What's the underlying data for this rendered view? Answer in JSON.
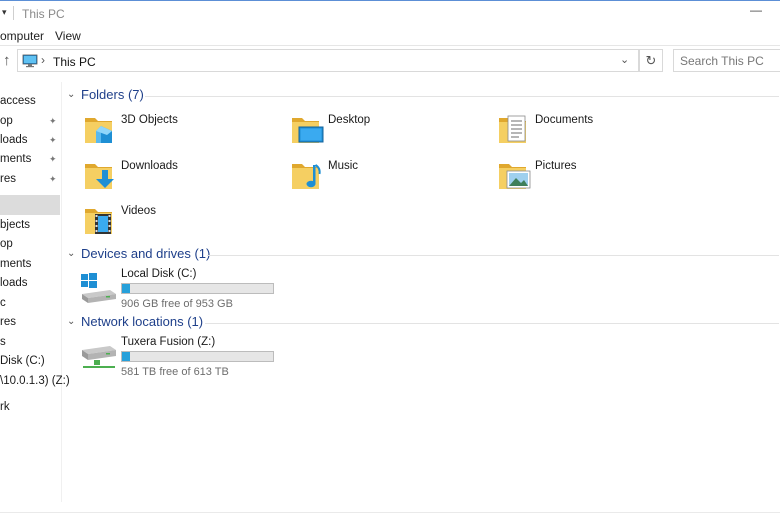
{
  "window": {
    "title": "This PC",
    "qa_glyph": "▾",
    "min_glyph": "—"
  },
  "ribbon": {
    "tabs": [
      "omputer",
      "View"
    ]
  },
  "address": {
    "up_glyph": "↑",
    "separator": "›",
    "crumb": "This PC",
    "dropdown_glyph": "⌄",
    "refresh_glyph": "↻",
    "search_placeholder": "Search This PC"
  },
  "nav": {
    "items": [
      {
        "label": "access",
        "pinned": false
      },
      {
        "label": "op",
        "pinned": true
      },
      {
        "label": "loads",
        "pinned": true
      },
      {
        "label": "ments",
        "pinned": true
      },
      {
        "label": "res",
        "pinned": true
      },
      {
        "label": "",
        "pinned": false,
        "selected": true
      },
      {
        "label": "bjects",
        "pinned": false
      },
      {
        "label": "op",
        "pinned": false
      },
      {
        "label": "ments",
        "pinned": false
      },
      {
        "label": "loads",
        "pinned": false
      },
      {
        "label": "c",
        "pinned": false
      },
      {
        "label": "res",
        "pinned": false
      },
      {
        "label": "s",
        "pinned": false
      },
      {
        "label": " Disk (C:)",
        "pinned": false
      },
      {
        "label": "\\10.0.1.3) (Z:)",
        "pinned": false
      },
      {
        "label": "rk",
        "pinned": false
      }
    ],
    "pin_glyph": "📌"
  },
  "sections": {
    "folders": {
      "title": "Folders (7)"
    },
    "drives": {
      "title": "Devices and drives (1)"
    },
    "network": {
      "title": "Network locations (1)"
    },
    "chevron": "⌄"
  },
  "folders": [
    {
      "name": "3D Objects",
      "icon": "3d-objects-folder-icon"
    },
    {
      "name": "Desktop",
      "icon": "desktop-folder-icon"
    },
    {
      "name": "Documents",
      "icon": "documents-folder-icon"
    },
    {
      "name": "Downloads",
      "icon": "downloads-folder-icon"
    },
    {
      "name": "Music",
      "icon": "music-folder-icon"
    },
    {
      "name": "Pictures",
      "icon": "pictures-folder-icon"
    },
    {
      "name": "Videos",
      "icon": "videos-folder-icon"
    }
  ],
  "drives": [
    {
      "name": "Local Disk (C:)",
      "free_text": "906 GB free of 953 GB",
      "used_fraction": 0.05,
      "icon": "windows-drive-icon"
    }
  ],
  "network_locations": [
    {
      "name": "Tuxera Fusion (Z:)",
      "free_text": "581 TB free of 613 TB",
      "used_fraction": 0.05,
      "icon": "network-drive-icon"
    }
  ],
  "colors": {
    "accent": "#26a0da",
    "header_text": "#1e3f8a",
    "folder_yellow": "#f2c94c"
  }
}
